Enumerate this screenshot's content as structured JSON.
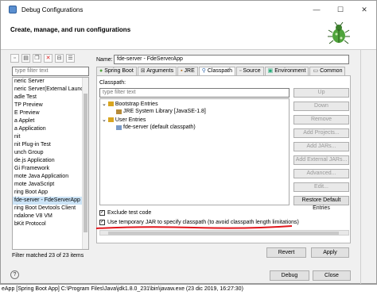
{
  "window": {
    "title": "Debug Configurations",
    "controls": [
      "—",
      "☐",
      "✕"
    ]
  },
  "banner": {
    "title": "Create, manage, and run configurations"
  },
  "left": {
    "filter_placeholder": "type filter text",
    "items": [
      "neric Server",
      "neric Server(External Launch)",
      "adle Test",
      "TP Preview",
      "E Preview",
      "a Applet",
      "a Application",
      "nit",
      "nit Plug-in Test",
      "unch Group",
      "de.js Application",
      "Gi Framework",
      "mote Java Application",
      "mote JavaScript",
      "ring Boot App",
      "fde-server - FdeServerApp",
      "ring Boot Devtools Client",
      "ndalone V8 VM",
      "bKit Protocol"
    ],
    "selected_index": 15,
    "status": "Filter matched 23 of 23 items"
  },
  "right": {
    "name_label": "Name:",
    "name_value": "fde-server - FdeServerApp",
    "tabs": [
      "Spring Boot",
      "Arguments",
      "JRE",
      "Classpath",
      "Source",
      "Environment",
      "Common"
    ],
    "active_tab": 3,
    "classpath_label": "Classpath:",
    "cp_filter_placeholder": "type filter text",
    "tree": {
      "bootstrap": "Bootstrap Entries",
      "jre": "JRE System Library [JavaSE-1.8]",
      "user": "User Entries",
      "project": "fde-server (default classpath)"
    },
    "buttons": [
      "Up",
      "Down",
      "Remove",
      "Add Projects...",
      "Add JARs...",
      "Add External JARs...",
      "Advanced...",
      "Edit...",
      "Restore Default Entries"
    ],
    "exclude_label": "Exclude test code",
    "temp_jar_label": "Use temporary JAR to specify classpath (to avoid classpath length limitations)",
    "revert_label": "Revert",
    "apply_label": "Apply"
  },
  "bottom": {
    "debug_label": "Debug",
    "close_label": "Close",
    "help": "?"
  },
  "cmdline": "eApp [Spring Boot App] C:\\Program Files\\Java\\jdk1.8.0_231\\bin\\javaw.exe (23 dic 2019, 16:27:30)",
  "colors": {
    "selection": "#cce4f7",
    "annotation": "#e0161c",
    "accent": "#5a8fd0"
  }
}
